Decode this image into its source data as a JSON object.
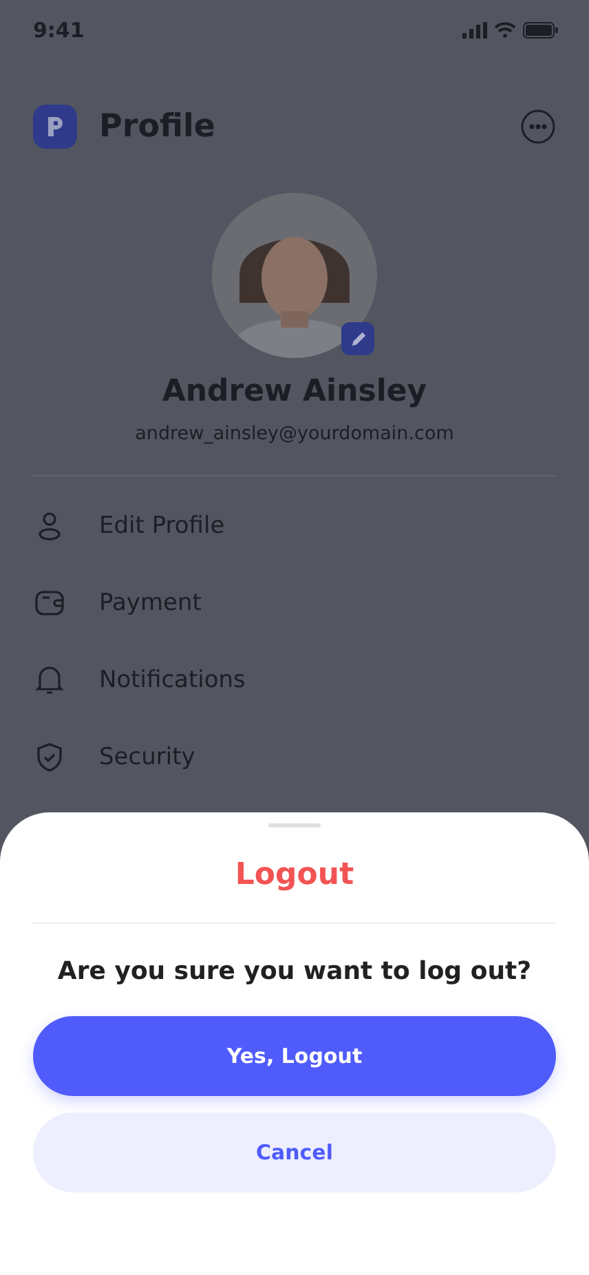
{
  "status_bar": {
    "time": "9:41"
  },
  "header": {
    "title": "Profile"
  },
  "profile": {
    "name": "Andrew Ainsley",
    "email": "andrew_ainsley@yourdomain.com"
  },
  "menu": [
    {
      "label": "Edit Profile"
    },
    {
      "label": "Payment"
    },
    {
      "label": "Notifications"
    },
    {
      "label": "Security"
    }
  ],
  "sheet": {
    "title": "Logout",
    "message": "Are you sure you want to log out?",
    "buttons": [
      {
        "label": "Yes, Logout",
        "kind": "primary"
      },
      {
        "label": "Cancel",
        "kind": "secondary"
      }
    ]
  }
}
